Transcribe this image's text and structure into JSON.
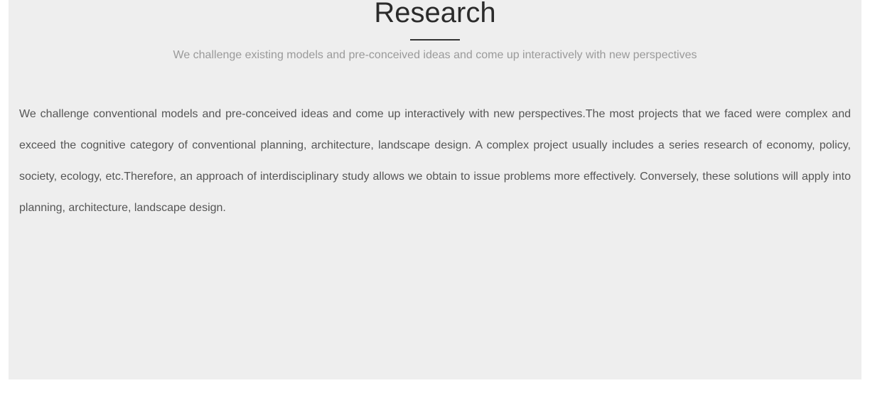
{
  "section": {
    "title": "Research",
    "subtitle": "We challenge existing models and pre-conceived ideas and come up interactively with new perspectives",
    "body": "We challenge conventional models and pre-conceived ideas and come up interactively with new perspectives.The most projects that we faced were complex and exceed the cognitive category of conventional planning, architecture, landscape design. A complex project usually includes a series research of economy, policy, society, ecology, etc.Therefore, an approach of interdisciplinary study allows we obtain to issue problems more effectively. Conversely, these solutions will apply into planning, architecture, landscape design."
  }
}
